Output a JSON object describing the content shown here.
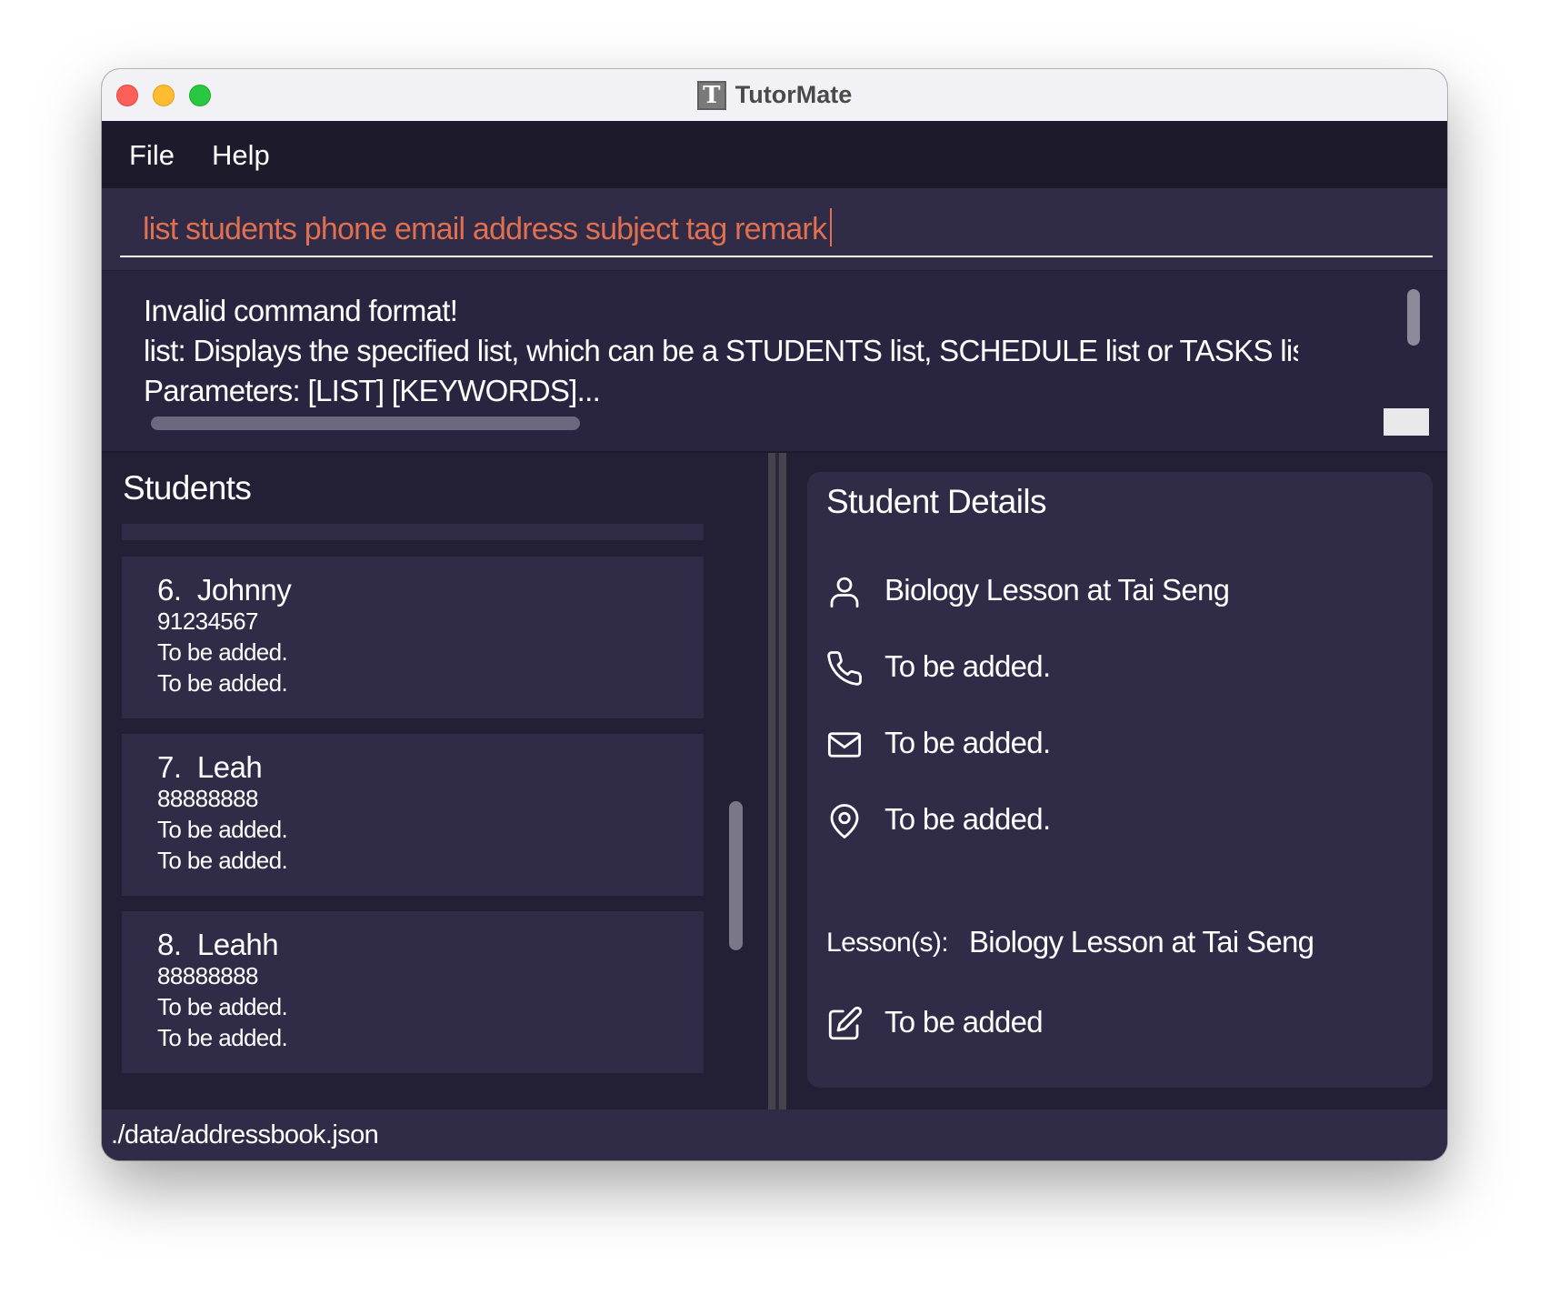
{
  "window": {
    "title": "TutorMate",
    "icon_letter": "T"
  },
  "menu": {
    "file": "File",
    "help": "Help"
  },
  "command": {
    "value": "list students phone email address subject tag remark"
  },
  "result": {
    "lines": [
      "Invalid command format!",
      "list: Displays the specified list, which can be a STUDENTS list, SCHEDULE list or TASKS list. De",
      "Parameters: [LIST] [KEYWORDS]..."
    ]
  },
  "students": {
    "title": "Students",
    "items": [
      {
        "index": "6.",
        "name": "Johnny",
        "phone": "91234567",
        "line3": "To be added.",
        "line4": "To be added."
      },
      {
        "index": "7.",
        "name": "Leah",
        "phone": "88888888",
        "line3": "To be added.",
        "line4": "To be added."
      },
      {
        "index": "8.",
        "name": "Leahh",
        "phone": "88888888",
        "line3": "To be added.",
        "line4": "To be added."
      }
    ]
  },
  "details": {
    "title": "Student Details",
    "name": "Biology Lesson at Tai Seng",
    "phone": "To be added.",
    "email": "To be added.",
    "address": "To be added.",
    "lesson_label": "Lesson(s):",
    "lesson_value": "Biology Lesson at Tai Seng",
    "remark": "To be added"
  },
  "icons": {
    "person": "person-icon",
    "phone": "phone-icon",
    "email": "mail-icon",
    "address": "location-pin-icon",
    "remark": "edit-icon"
  },
  "status": {
    "path": "./data/addressbook.json"
  },
  "colors": {
    "command_text": "#e0704f",
    "background": "#231f34",
    "panel": "#302b47"
  }
}
